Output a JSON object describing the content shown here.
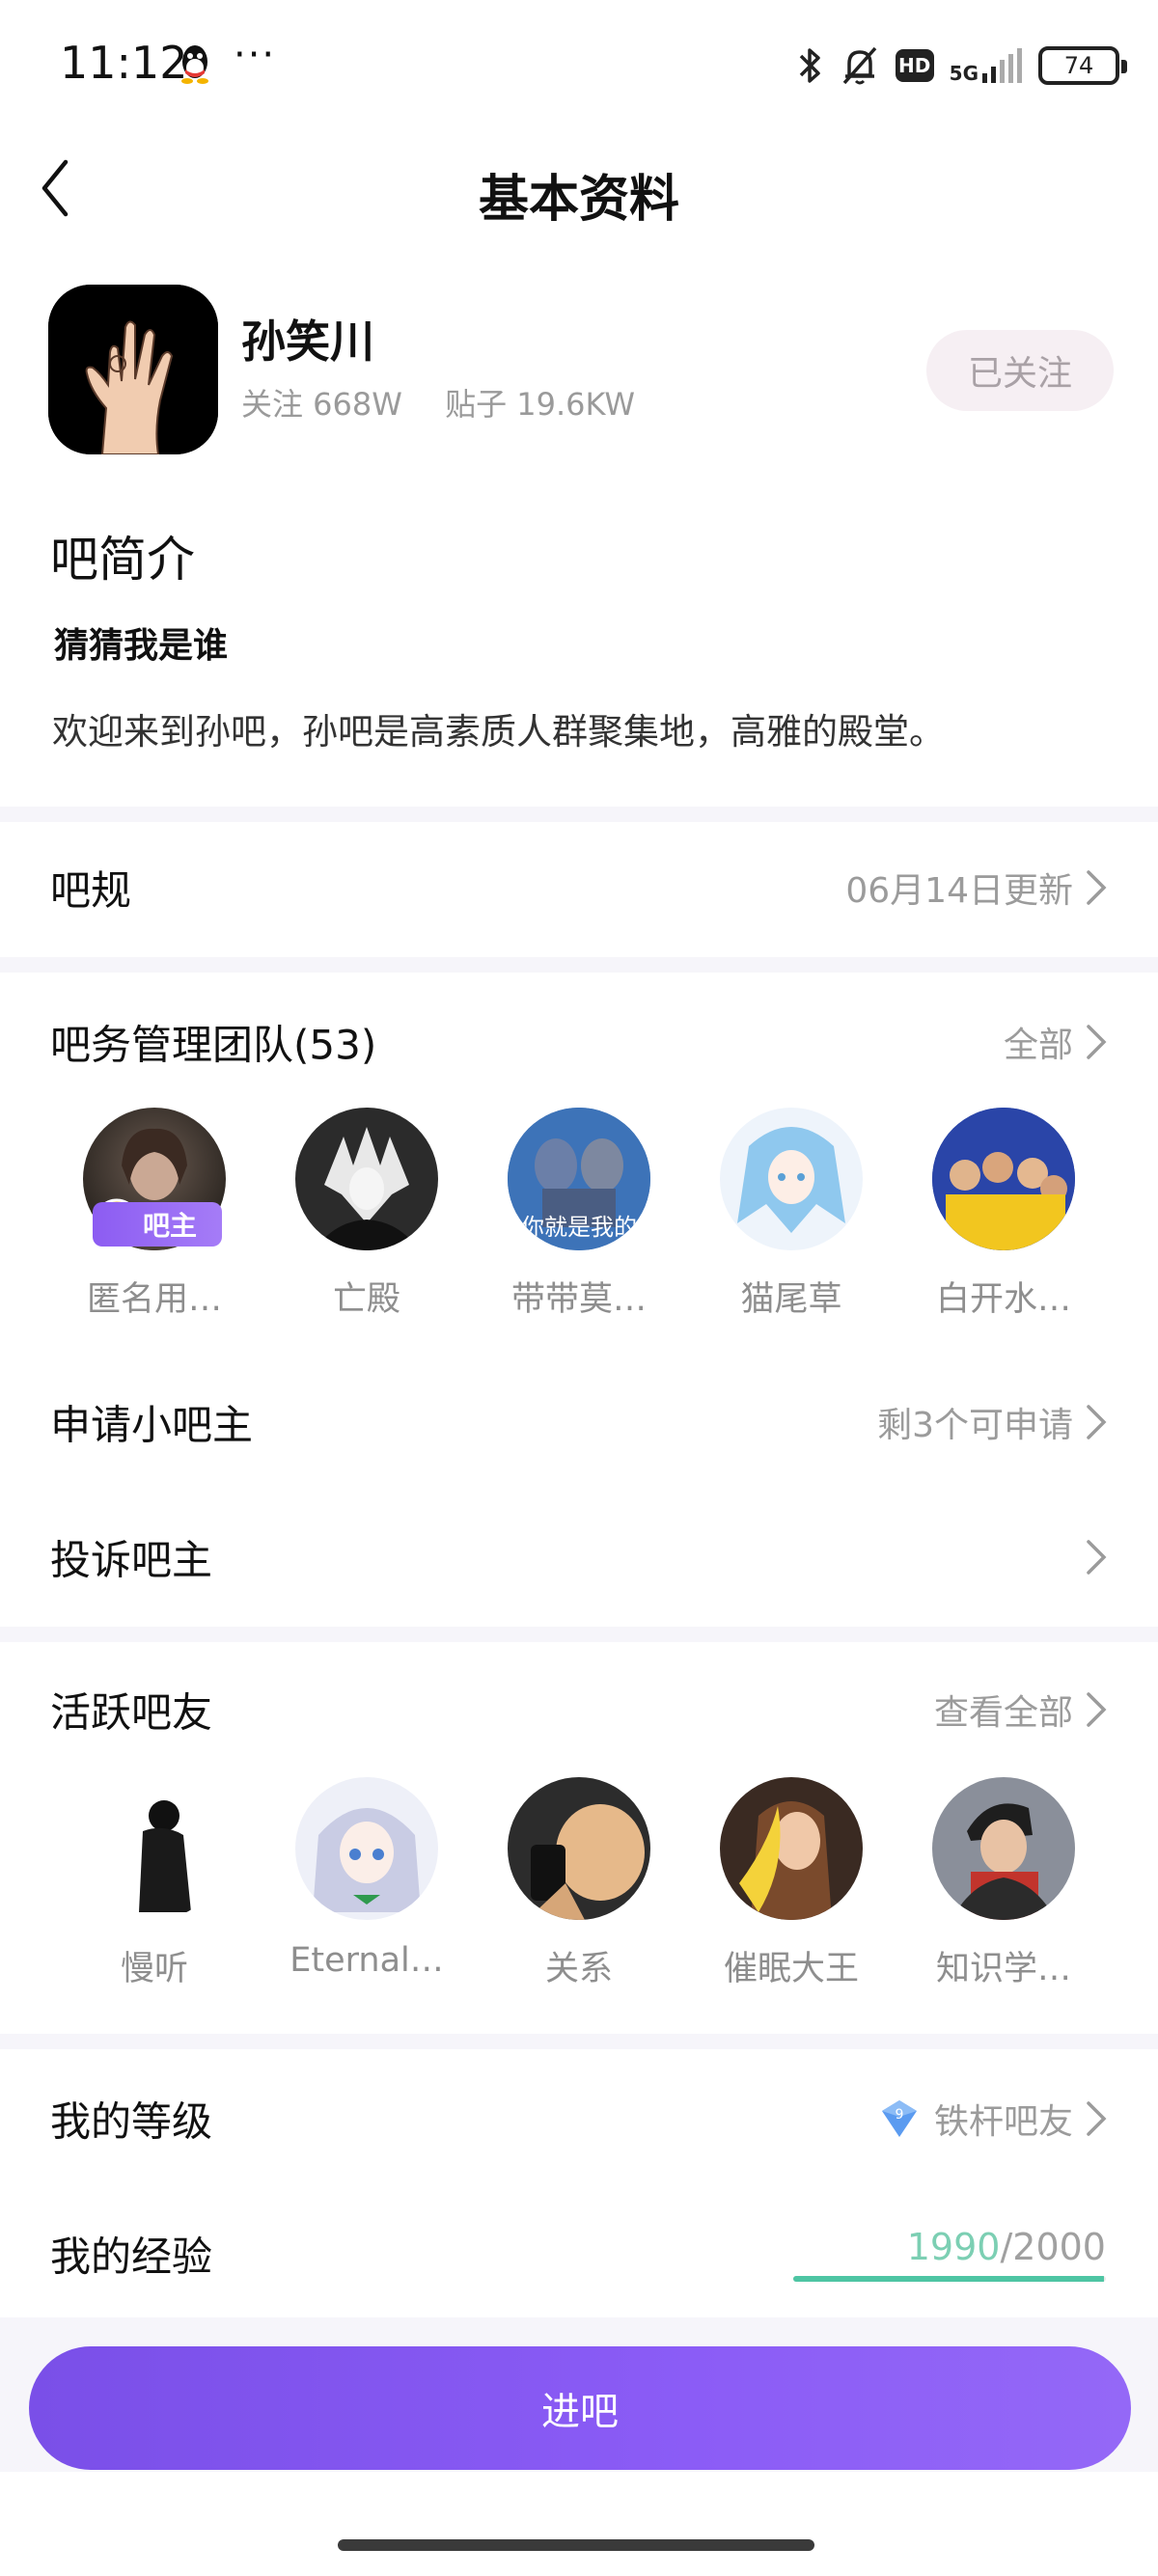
{
  "status_bar": {
    "time": "11:12",
    "more": "···",
    "network": "5G",
    "battery": "74",
    "icons": [
      "qq-icon",
      "bluetooth-icon",
      "mute-bell-icon",
      "hd-icon",
      "signal-icon",
      "battery-icon"
    ]
  },
  "header": {
    "title": "基本资料"
  },
  "forum": {
    "name": "孙笑川",
    "follows": "关注 668W",
    "posts": "贴子 19.6KW",
    "follow_button": "已关注"
  },
  "intro": {
    "heading": "吧简介",
    "subtitle": "猜猜我是谁",
    "text": "欢迎来到孙吧，孙吧是高素质人群聚集地，高雅的殿堂。"
  },
  "rules": {
    "label": "吧规",
    "meta": "06月14日更新"
  },
  "team": {
    "label": "吧务管理团队(53)",
    "meta": "全部",
    "owner_badge": "吧主",
    "members": [
      {
        "name": "匿名用…"
      },
      {
        "name": "亡殿"
      },
      {
        "name": "带带莫…",
        "overlay": "你就是我的"
      },
      {
        "name": "猫尾草"
      },
      {
        "name": "白开水…"
      }
    ]
  },
  "apply": {
    "label": "申请小吧主",
    "meta": "剩3个可申请"
  },
  "complain": {
    "label": "投诉吧主"
  },
  "active": {
    "label": "活跃吧友",
    "meta": "查看全部",
    "members": [
      {
        "name": "慢听"
      },
      {
        "name": "Eternal…"
      },
      {
        "name": "关系"
      },
      {
        "name": "催眠大王"
      },
      {
        "name": "知识学…"
      }
    ]
  },
  "level": {
    "label": "我的等级",
    "gem_number": "9",
    "value": "铁杆吧友"
  },
  "exp": {
    "label": "我的经验",
    "current": "1990",
    "separator": "/",
    "max": "2000",
    "progress": 0.995
  },
  "enter_button": "进吧",
  "colors": {
    "accent": "#8b5cf6",
    "exp_green": "#4ec5a3",
    "muted": "#9b9b9b"
  }
}
